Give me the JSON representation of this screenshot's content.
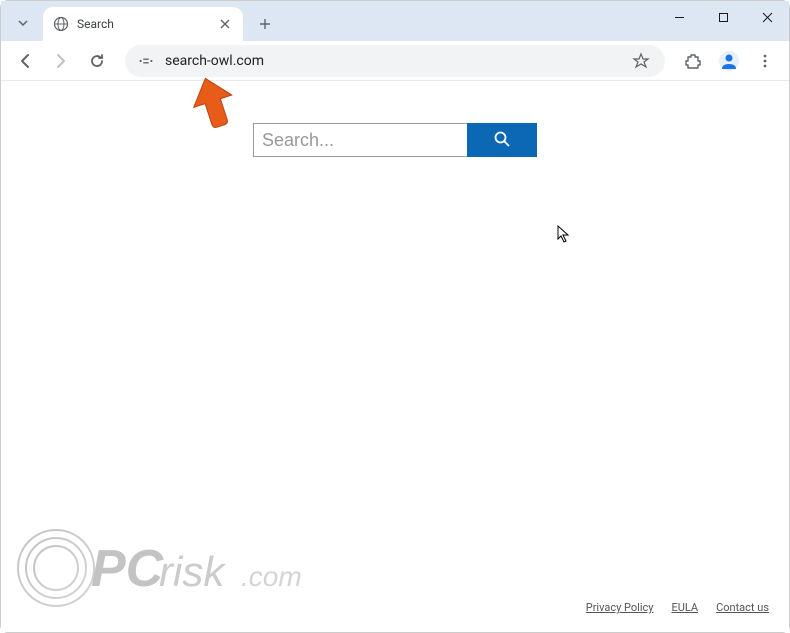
{
  "tab": {
    "title": "Search"
  },
  "omnibox": {
    "url": "search-owl.com"
  },
  "page": {
    "search_placeholder": "Search..."
  },
  "footer": {
    "privacy": "Privacy Policy",
    "eula": "EULA",
    "contact": "Contact us"
  },
  "watermark": {
    "text": "PCrisk.com"
  }
}
